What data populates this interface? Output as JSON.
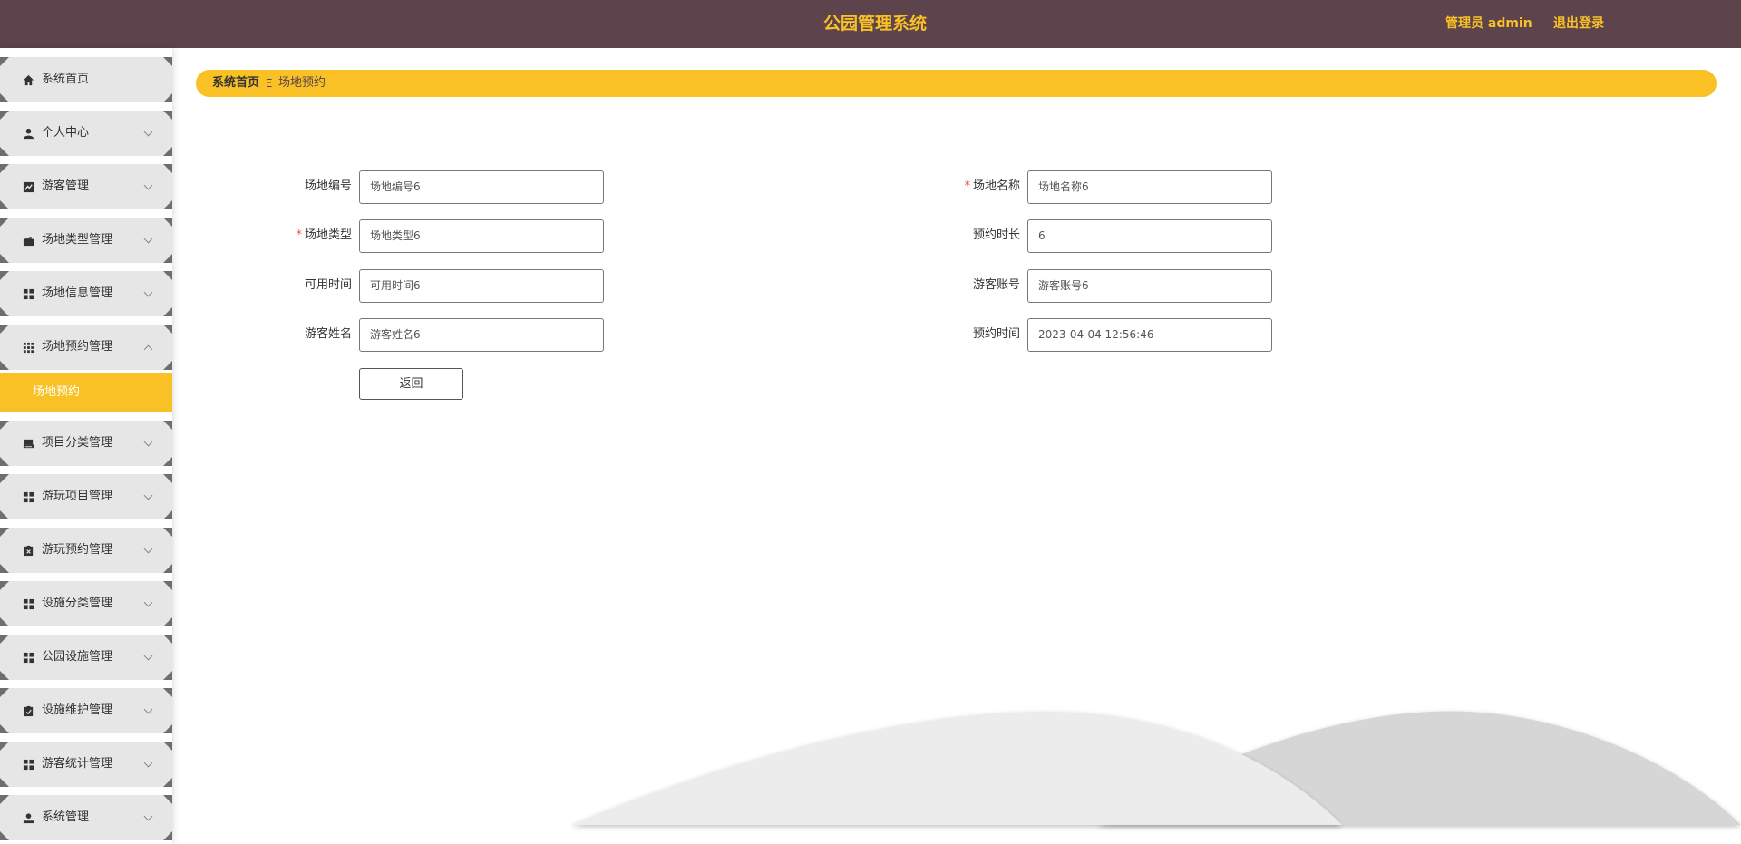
{
  "header": {
    "title": "公园管理系统",
    "user": "管理员 admin",
    "logout": "退出登录"
  },
  "sidebar": {
    "items": [
      {
        "label": "系统首页",
        "icon": "home-icon"
      },
      {
        "label": "个人中心",
        "icon": "person-icon"
      },
      {
        "label": "游客管理",
        "icon": "trend-icon"
      },
      {
        "label": "场地类型管理",
        "icon": "wallet-icon"
      },
      {
        "label": "场地信息管理",
        "icon": "grid-icon"
      },
      {
        "label": "场地预约管理",
        "icon": "apps-icon"
      },
      {
        "label": "项目分类管理",
        "icon": "printer-icon"
      },
      {
        "label": "游玩项目管理",
        "icon": "grid-icon"
      },
      {
        "label": "游玩预约管理",
        "icon": "clipboard-x-icon"
      },
      {
        "label": "设施分类管理",
        "icon": "grid-icon"
      },
      {
        "label": "公园设施管理",
        "icon": "grid-icon"
      },
      {
        "label": "设施维护管理",
        "icon": "clipboard-check-icon"
      },
      {
        "label": "游客统计管理",
        "icon": "grid-icon"
      },
      {
        "label": "系统管理",
        "icon": "user-icon"
      }
    ],
    "active_sub": "场地预约"
  },
  "breadcrumb": {
    "home": "系统首页",
    "separator": "Ξ",
    "current": "场地预约"
  },
  "form": {
    "venue_no_label": "场地编号",
    "venue_no_value": "场地编号6",
    "venue_name_label": "场地名称",
    "venue_name_value": "场地名称6",
    "venue_type_label": "场地类型",
    "venue_type_value": "场地类型6",
    "duration_label": "预约时长",
    "duration_value": "6",
    "available_time_label": "可用时间",
    "available_time_value": "可用时间6",
    "visitor_account_label": "游客账号",
    "visitor_account_value": "游客账号6",
    "visitor_name_label": "游客姓名",
    "visitor_name_value": "游客姓名6",
    "booking_time_label": "预约时间",
    "booking_time_value": "2023-04-04 12:56:46",
    "required_mark": "*",
    "back_button": "返回"
  },
  "colors": {
    "header_bg": "#5c434c",
    "accent": "#f9c126",
    "required": "#e94b4b"
  }
}
